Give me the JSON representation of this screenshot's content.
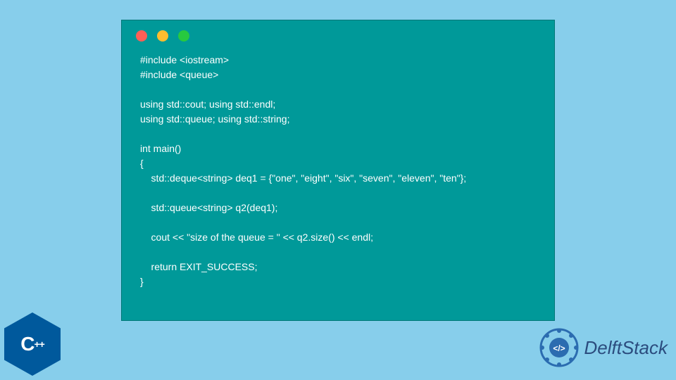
{
  "code": {
    "lines": [
      "#include <iostream>",
      "#include <queue>",
      "",
      "using std::cout; using std::endl;",
      "using std::queue; using std::string;",
      "",
      "int main()",
      "{",
      "    std::deque<string> deq1 = {\"one\", \"eight\", \"six\", \"seven\", \"eleven\", \"ten\"};",
      "",
      "    std::queue<string> q2(deq1);",
      "",
      "    cout << \"size of the queue = \" << q2.size() << endl;",
      "",
      "    return EXIT_SUCCESS;",
      "}"
    ]
  },
  "badge": {
    "cpp_c": "C",
    "cpp_plus": "++"
  },
  "brand": {
    "name": "DelftStack"
  },
  "colors": {
    "bg": "#87CEEB",
    "window": "#009999",
    "dot_red": "#FF5F56",
    "dot_yellow": "#FFBD2E",
    "dot_green": "#27C93F",
    "cpp_blue": "#00599C",
    "brand_blue": "#2B4C7E"
  }
}
